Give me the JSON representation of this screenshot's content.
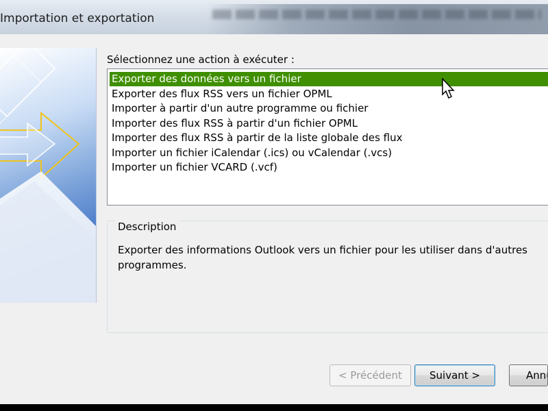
{
  "window": {
    "title": "Importation et exportation"
  },
  "main": {
    "prompt": "Sélectionnez une action à exécuter :",
    "actions": [
      "Exporter des données vers un fichier",
      "Exporter des flux RSS vers un fichier OPML",
      "Importer à partir d'un autre programme ou fichier",
      "Importer des flux RSS à partir d'un fichier OPML",
      "Importer des flux RSS à partir de la liste globale des flux",
      "Importer un fichier iCalendar (.ics) ou vCalendar (.vcs)",
      "Importer un fichier VCARD (.vcf)"
    ],
    "selected_index": 0,
    "description_label": "Description",
    "description_text": "Exporter des informations Outlook vers un fichier pour les utiliser dans d'autres programmes."
  },
  "buttons": {
    "previous": "< Précédent",
    "next": "Suivant >",
    "cancel": "Annuler"
  },
  "colors": {
    "selection": "#3f8f00",
    "selection_text": "#ffffff",
    "banner_arrow": "#f0c419"
  }
}
